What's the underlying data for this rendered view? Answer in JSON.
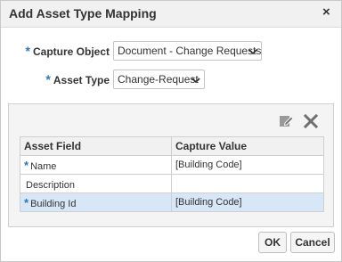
{
  "dialog": {
    "title": "Add Asset Type Mapping",
    "close_label": "×"
  },
  "form": {
    "capture_object": {
      "label": "Capture Object",
      "required_mark": "*",
      "selected": "Document - Change Requests"
    },
    "asset_type": {
      "label": "Asset Type",
      "required_mark": "*",
      "selected": "Change-Request"
    }
  },
  "toolbar": {
    "edit_icon": "edit-icon",
    "delete_icon": "delete-icon"
  },
  "table": {
    "columns": [
      "Asset Field",
      "Capture Value"
    ],
    "rows": [
      {
        "required": "*",
        "field": "Name",
        "value": "[Building Code]"
      },
      {
        "required": "",
        "field": "Description",
        "value": ""
      },
      {
        "required": "*",
        "field": "Building Id",
        "value": "[Building Code]",
        "selected": true
      }
    ]
  },
  "buttons": {
    "ok": "OK",
    "cancel": "Cancel"
  },
  "colors": {
    "required": "#2a7ab5",
    "selected_row": "#d7e7f7",
    "title_bar": "#f1f1f1",
    "panel_bg": "#f4f4f4"
  }
}
